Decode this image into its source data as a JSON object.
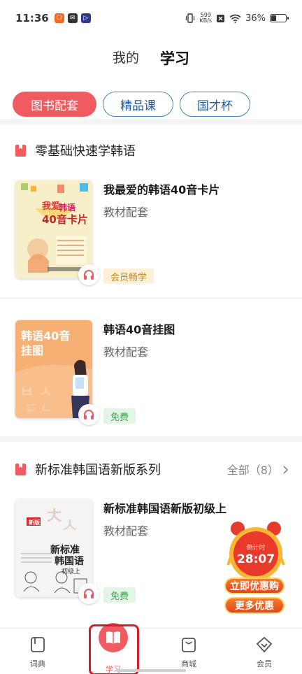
{
  "status_bar": {
    "time": "11:36",
    "net_speed_top": "599",
    "net_speed_bottom": "KB/s",
    "battery": "36%",
    "battery_level": 0.36
  },
  "top_tabs": [
    {
      "label": "我的",
      "active": false
    },
    {
      "label": "学习",
      "active": true
    }
  ],
  "pills": [
    {
      "label": "图书配套",
      "active": true
    },
    {
      "label": "精品课",
      "active": false
    },
    {
      "label": "国才杯",
      "active": false
    }
  ],
  "sections": [
    {
      "title": "零基础快速学韩语",
      "items": [
        {
          "title": "我最爱的韩语40音卡片",
          "subtitle": "教材配套",
          "tag": "会员畅学"
        },
        {
          "title": "韩语40音挂图",
          "subtitle": "教材配套",
          "tag": "免费"
        }
      ]
    },
    {
      "title": "新标准韩国语新版系列",
      "more": "全部（8）",
      "items": [
        {
          "title": "新标准韩国语新版初级上",
          "subtitle": "教材配套",
          "tag": "免费"
        }
      ]
    }
  ],
  "covers": {
    "c1_line1": "我爱",
    "c1_line2": "韩语",
    "c1_line3": "40音卡片",
    "c2_text": "韩语40音挂图",
    "c3_line1": "新标准",
    "c3_line2": "韩国语",
    "c3_line3": "初级上",
    "c3_badge": "新版"
  },
  "countdown": {
    "label": "倒计时",
    "time": "28:07",
    "primary_button": "立即优惠购",
    "secondary_button": "更多优惠"
  },
  "bottom_nav": [
    {
      "label": "词典",
      "icon": "dictionary-icon",
      "active": false
    },
    {
      "label": "学习",
      "icon": "book-open-icon",
      "active": true
    },
    {
      "label": "商城",
      "icon": "shopping-bag-icon",
      "active": false
    },
    {
      "label": "会员",
      "icon": "diamond-icon",
      "active": false
    }
  ],
  "colors": {
    "accent": "#ef5b5f",
    "pill_outline": "#3a87c9",
    "free_tag": "#3aa64b",
    "member_tag": "#c68a2b"
  }
}
